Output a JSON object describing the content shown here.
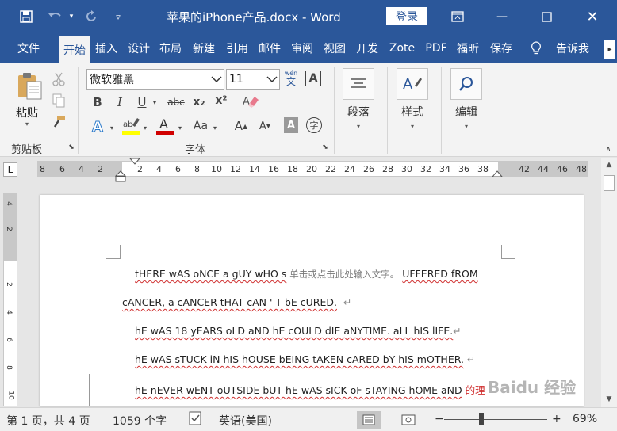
{
  "titlebar": {
    "title": "苹果的iPhone产品.docx  -  Word",
    "login": "登录"
  },
  "tabs": [
    "文件",
    "开始",
    "插入",
    "设计",
    "布局",
    "新建",
    "引用",
    "邮件",
    "审阅",
    "视图",
    "开发",
    "Zote",
    "PDF",
    "福昕",
    "保存",
    "告诉我"
  ],
  "active_tab": "开始",
  "ribbon": {
    "clipboard": {
      "paste": "粘贴",
      "label": "剪贴板"
    },
    "font": {
      "font_name": "微软雅黑",
      "font_size": "11",
      "label": "字体",
      "phonetic": "wén",
      "phonetic_char": "文",
      "border_char": "A",
      "bold": "B",
      "italic": "I",
      "underline": "U",
      "strike": "abc",
      "sub": "x₂",
      "sup": "x²",
      "case": "Aa",
      "circle": "字",
      "grow": "A",
      "shrink": "A",
      "shade": "A",
      "eraser": "清除",
      "highlight_color": "#ffff00",
      "font_color": "#d00000"
    },
    "paragraph": {
      "label": "段落"
    },
    "styles": {
      "label": "样式"
    },
    "editing": {
      "label": "编辑"
    }
  },
  "ruler": {
    "left_nums": [
      "8",
      "6",
      "4",
      "2"
    ],
    "right_nums": [
      "2",
      "4",
      "6",
      "8",
      "10",
      "12",
      "14",
      "16",
      "18",
      "20",
      "22",
      "24",
      "26",
      "28",
      "30",
      "32",
      "34",
      "36",
      "38"
    ],
    "tail_nums": [
      "42",
      "44",
      "46",
      "48"
    ],
    "tab_selector": "L"
  },
  "vruler": [
    "4",
    "2",
    "2",
    "4",
    "6",
    "8",
    "10"
  ],
  "document": {
    "lines": [
      {
        "pre": "tHERE wAS oNCE a gUY wHO s",
        "placeholder": "单击或点击此处输入文字。",
        "post": "UFFERED fROM"
      },
      {
        "pre": "cANCER, a cANCER tHAT cAN ' T bE cURED.",
        "placeholder": "",
        "post": ""
      },
      {
        "pre": "hE wAS 18 yEARS oLD aND hE cOULD dIE aNYTIME. aLL hIS lIFE.",
        "placeholder": "",
        "post": ""
      },
      {
        "pre": "hE wAS sTUCK iN hIS hOUSE bEING tAKEN cARED bY hIS mOTHER.",
        "placeholder": "",
        "post": ""
      },
      {
        "pre": "hE nEVER wENT oUTSIDE bUT hE wAS sICK oF sTAYING hOME aND",
        "placeholder": "",
        "post": "的理"
      }
    ]
  },
  "status": {
    "page": "第 1 页，共 4 页",
    "words": "1059 个字",
    "lang": "英语(美国)",
    "zoom": "69%",
    "zoom_minus": "−",
    "zoom_plus": "+"
  },
  "watermark": "Baidu 经验"
}
